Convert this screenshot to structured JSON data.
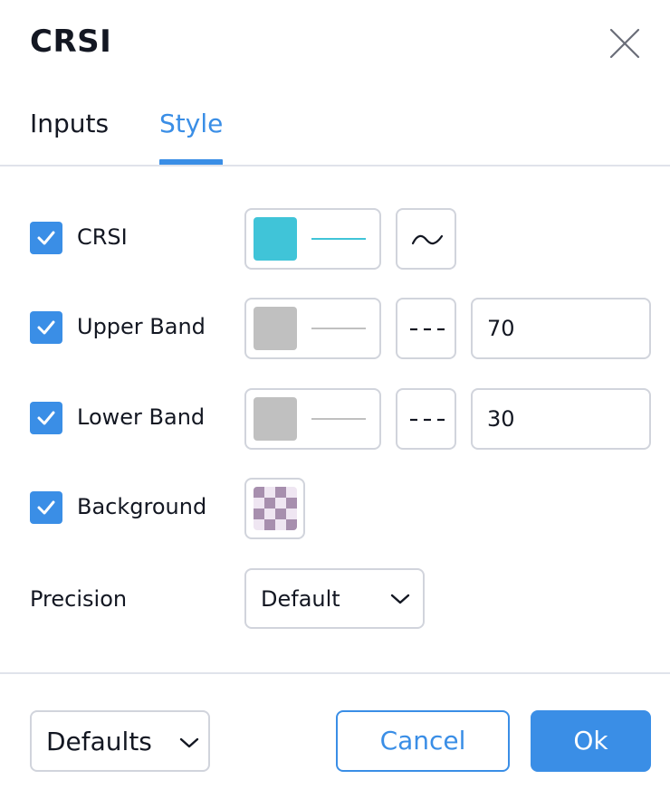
{
  "dialog": {
    "title": "CRSI",
    "close_icon": "close-icon"
  },
  "tabs": [
    {
      "label": "Inputs",
      "active": false
    },
    {
      "label": "Style",
      "active": true
    }
  ],
  "style_rows": {
    "crsi": {
      "label": "CRSI",
      "checked": true,
      "color": "#40c4d8",
      "line_color": "#40c4d8",
      "plot_icon": "line-plot-icon"
    },
    "upper_band": {
      "label": "Upper Band",
      "checked": true,
      "color": "#c0c0c0",
      "line_color": "#c0c0c0",
      "line_style_icon": "dashed-line-icon",
      "value": "70"
    },
    "lower_band": {
      "label": "Lower Band",
      "checked": true,
      "color": "#c0c0c0",
      "line_color": "#c0c0c0",
      "line_style_icon": "dashed-line-icon",
      "value": "30"
    },
    "background": {
      "label": "Background",
      "checked": true,
      "color": "#9c7ea8",
      "icon": "checkerboard-swatch-icon"
    }
  },
  "precision": {
    "label": "Precision",
    "value": "Default"
  },
  "footer": {
    "defaults_label": "Defaults",
    "cancel_label": "Cancel",
    "ok_label": "Ok"
  },
  "colors": {
    "accent": "#3a8ee6",
    "border": "#d1d4dc",
    "text": "#131722"
  }
}
